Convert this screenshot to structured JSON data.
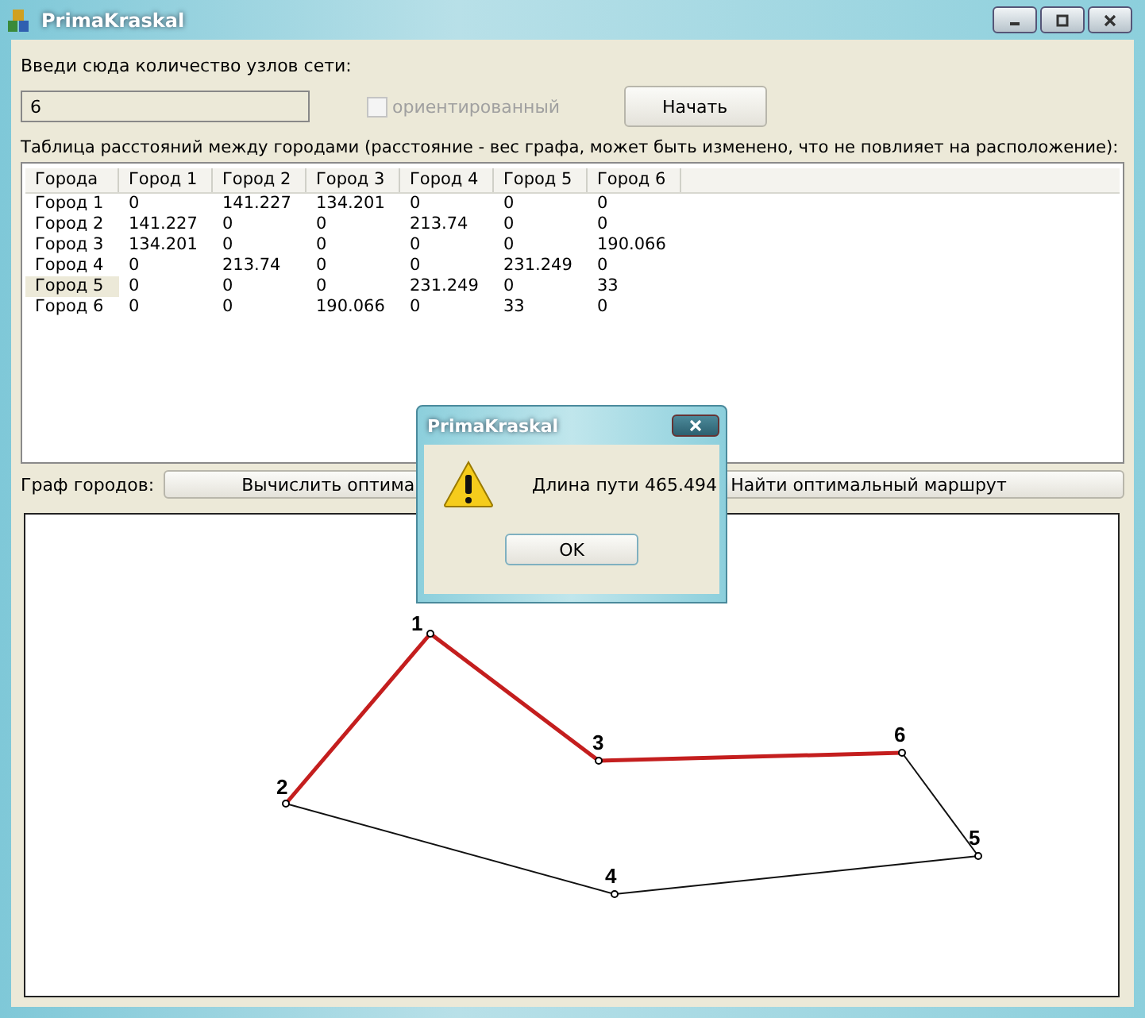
{
  "window": {
    "title": "PrimaKraskal"
  },
  "nodes_label": "Введи сюда количество узлов сети:",
  "nodes_field": {
    "value": "6"
  },
  "directed": {
    "label": "ориентированный",
    "checked": false,
    "disabled": true
  },
  "start_button": "Начать",
  "table_label": "Таблица расстояний между городами (расстояние - вес графа, может быть изменено, что не повлияет на расположение):",
  "table": {
    "columns": [
      "Города",
      "Город 1",
      "Город 2",
      "Город 3",
      "Город 4",
      "Город 5",
      "Город 6"
    ],
    "rows": [
      {
        "cells": [
          "Город 1",
          "0",
          "141.227",
          "134.201",
          "0",
          "0",
          "0"
        ],
        "selected": false
      },
      {
        "cells": [
          "Город 2",
          "141.227",
          "0",
          "0",
          "213.74",
          "0",
          "0"
        ],
        "selected": false
      },
      {
        "cells": [
          "Город 3",
          "134.201",
          "0",
          "0",
          "0",
          "0",
          "190.066"
        ],
        "selected": false
      },
      {
        "cells": [
          "Город 4",
          "0",
          "213.74",
          "0",
          "0",
          "231.249",
          "0"
        ],
        "selected": false
      },
      {
        "cells": [
          "Город 5",
          "0",
          "0",
          "0",
          "231.249",
          "0",
          "33"
        ],
        "selected": true
      },
      {
        "cells": [
          "Город 6",
          "0",
          "0",
          "190.066",
          "0",
          "33",
          "0"
        ],
        "selected": false
      }
    ]
  },
  "graph_label": "Граф городов:",
  "graph_buttons": [
    "Вычислить оптима",
    "Найти оптимальный маршрут"
  ],
  "graph": {
    "nodes": [
      "1",
      "2",
      "3",
      "4",
      "5",
      "6"
    ],
    "edges": [
      {
        "on_path": true
      },
      {
        "on_path": true
      },
      {
        "on_path": true
      },
      {
        "on_path": false
      },
      {
        "on_path": false
      },
      {
        "on_path": false
      }
    ]
  },
  "dialog": {
    "title": "PrimaKraskal",
    "message": "Длина пути 465.494",
    "button": "OK"
  }
}
